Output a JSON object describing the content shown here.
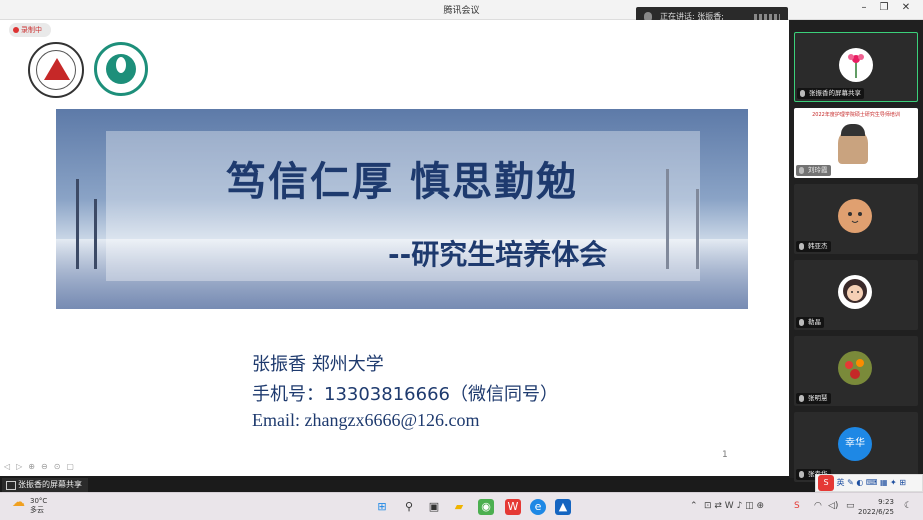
{
  "window": {
    "title": "腾讯会议"
  },
  "speaking": {
    "text": "正在讲话: 张振香;"
  },
  "recording": {
    "label": "录制中"
  },
  "slide": {
    "title": "笃信仁厚  慎思勤勉",
    "subtitle": "--研究生培养体会",
    "presenter": "张振香     郑州大学",
    "phone": "手机号：13303816666（微信同号）",
    "email": "Email: zhangzx6666@126.com",
    "page": "1"
  },
  "share_label": "张振香的屏幕共享",
  "participants": [
    {
      "name": "张振香的屏幕共享",
      "avatar": "flower"
    },
    {
      "name": "刘玲霞",
      "avatar": "video"
    },
    {
      "name": "韩亚杰",
      "avatar": "cat"
    },
    {
      "name": "勒晶",
      "avatar": "girl"
    },
    {
      "name": "张明慧",
      "avatar": "fruit"
    },
    {
      "name": "张幸华",
      "avatar": "text",
      "initials": "幸华"
    }
  ],
  "video_slide_caption": "2022年度护理学院硕士研究生导师培训",
  "taskbar": {
    "weather_temp": "30°C",
    "weather_desc": "多云",
    "time": "9:23",
    "date": "2022/6/25",
    "ime_lang": "英"
  },
  "colors": {
    "accent": "#1e3a6e",
    "active_border": "#3bd07a",
    "avatar_blue": "#1e88e5"
  }
}
